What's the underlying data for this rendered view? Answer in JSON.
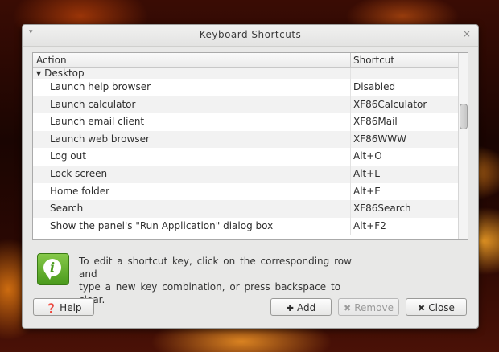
{
  "window": {
    "title": "Keyboard Shortcuts",
    "menu_glyph": "▾",
    "close_glyph": "×"
  },
  "table": {
    "columns": [
      "Action",
      "Shortcut"
    ],
    "group": {
      "label": "Desktop",
      "expander": "▼"
    },
    "rows": [
      {
        "action": "Launch help browser",
        "shortcut": "Disabled"
      },
      {
        "action": "Launch calculator",
        "shortcut": "XF86Calculator"
      },
      {
        "action": "Launch email client",
        "shortcut": "XF86Mail"
      },
      {
        "action": "Launch web browser",
        "shortcut": "XF86WWW"
      },
      {
        "action": "Log out",
        "shortcut": "Alt+O"
      },
      {
        "action": "Lock screen",
        "shortcut": "Alt+L"
      },
      {
        "action": "Home folder",
        "shortcut": "Alt+E"
      },
      {
        "action": "Search",
        "shortcut": "XF86Search"
      },
      {
        "action": "Show the panel's \"Run Application\" dialog box",
        "shortcut": "Alt+F2"
      }
    ]
  },
  "info": {
    "icon": "info-icon",
    "glyph": "i",
    "line1": "To edit a shortcut key, click on the corresponding row and",
    "line2": "type a new key combination, or press backspace to clear."
  },
  "buttons": {
    "help": {
      "label": "Help",
      "icon": "❓"
    },
    "add": {
      "label": "Add",
      "icon": "✚"
    },
    "remove": {
      "label": "Remove",
      "icon": "✖"
    },
    "close": {
      "label": "Close",
      "icon": "✖"
    }
  },
  "colors": {
    "info_icon": "#5aae2a",
    "window_bg": "#e8e8e7"
  }
}
